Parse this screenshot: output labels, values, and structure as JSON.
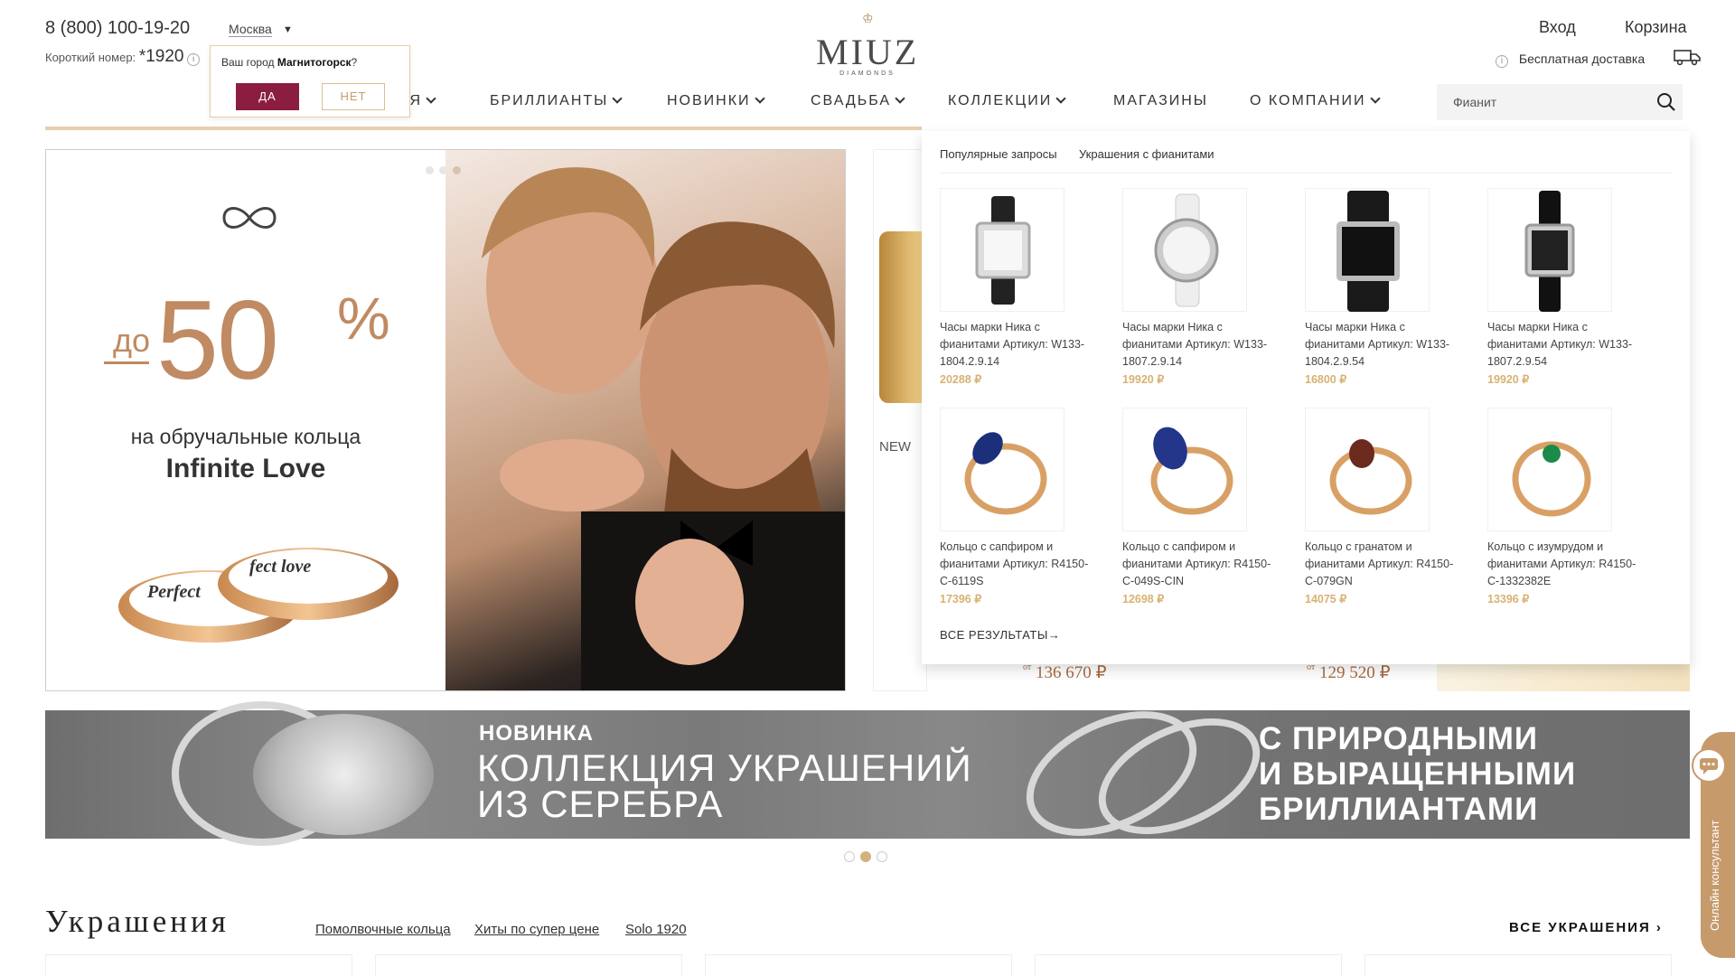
{
  "header": {
    "phone": "8 (800) 100-19-20",
    "city": "Москва",
    "short_number_label": "Короткий номер:",
    "short_number": "*1920",
    "login": "Вход",
    "cart": "Корзина",
    "delivery": "Бесплатная доставка",
    "logo": "MIUZ",
    "logo_sub": "DIAMONDS"
  },
  "city_popup": {
    "question_prefix": "Ваш город ",
    "city": "Магнитогорск",
    "question_suffix": "?",
    "yes": "ДА",
    "no": "НЕТ"
  },
  "nav": [
    {
      "label": "ИЯ"
    },
    {
      "label": "БРИЛЛИАНТЫ"
    },
    {
      "label": "НОВИНКИ"
    },
    {
      "label": "СВАДЬБА"
    },
    {
      "label": "КОЛЛЕКЦИИ"
    },
    {
      "label": "МАГАЗИНЫ"
    },
    {
      "label": "О КОМПАНИИ"
    }
  ],
  "search": {
    "value": "Фианит"
  },
  "search_dropdown": {
    "popular_label": "Популярные запросы",
    "popular_query": "Украшения с фианитами",
    "all_results": "ВСЕ РЕЗУЛЬТАТЫ→",
    "products": [
      {
        "name_l1": "Часы марки Ника с",
        "name_l2": "фианитами Артикул: W133-",
        "name_l3": "1804.2.9.14",
        "price": "20288 ₽"
      },
      {
        "name_l1": "Часы марки Ника с",
        "name_l2": "фианитами Артикул: W133-",
        "name_l3": "1807.2.9.14",
        "price": "19920 ₽"
      },
      {
        "name_l1": "Часы марки Ника с",
        "name_l2": "фианитами Артикул: W133-",
        "name_l3": "1804.2.9.54",
        "price": "16800 ₽"
      },
      {
        "name_l1": "Часы марки Ника с",
        "name_l2": "фианитами Артикул: W133-",
        "name_l3": "1807.2.9.54",
        "price": "19920 ₽"
      },
      {
        "name_l1": "Кольцо с сапфиром и",
        "name_l2": "фианитами Артикул: R4150-",
        "name_l3": "C-6119S",
        "price": "17396 ₽"
      },
      {
        "name_l1": "Кольцо с сапфиром и",
        "name_l2": "фианитами Артикул: R4150-",
        "name_l3": "C-049S-CIN",
        "price": "12698 ₽"
      },
      {
        "name_l1": "Кольцо с гранатом и",
        "name_l2": "фианитами Артикул: R4150-",
        "name_l3": "C-079GN",
        "price": "14075 ₽"
      },
      {
        "name_l1": "Кольцо с изумрудом и",
        "name_l2": "фианитами Артикул: R4150-",
        "name_l3": "C-1332382E",
        "price": "13396 ₽"
      }
    ]
  },
  "hero": {
    "do": "до",
    "percent_value": "50",
    "percent_sign": "%",
    "subtitle": "на обручальные кольца",
    "collection": "Infinite Love",
    "ring_text1": "Perfect",
    "ring_text2": "fect love"
  },
  "side_cards": {
    "new_label": "NEW",
    "price1_from": "от",
    "price1": "136 670 ₽",
    "price2_from": "от",
    "price2": "129 520 ₽"
  },
  "banner": {
    "new_label": "НОВИНКА",
    "title_line1": "КОЛЛЕКЦИЯ УКРАШЕНИЙ",
    "title_line2": "ИЗ СЕРЕБРА",
    "right_line1": "С ПРИРОДНЫМИ",
    "right_line2": "И ВЫРАЩЕННЫМИ",
    "right_line3": "БРИЛЛИАНТАМИ"
  },
  "jewelry_section": {
    "title": "Украшения",
    "links": [
      "Помолвочные кольца",
      "Хиты по супер цене",
      "Solo 1920"
    ],
    "all": "ВСЕ УКРАШЕНИЯ"
  },
  "consultant": {
    "label": "Онлайн консультант"
  },
  "colors": {
    "accent_gold": "#c08a62",
    "brand_burgundy": "#8b1e40",
    "price_gold": "#d7b273"
  }
}
